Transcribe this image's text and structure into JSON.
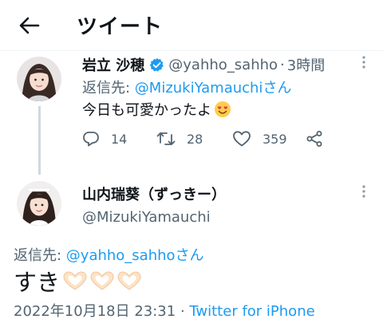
{
  "header": {
    "title": "ツイート",
    "back_icon": "arrow-left-icon"
  },
  "reply_tweet": {
    "author_name": "岩立 沙穂",
    "verified": true,
    "handle": "@yahho_sahho",
    "separator": "·",
    "time": "3時間",
    "reply_prefix": "返信先: ",
    "reply_to": "@MizukiYamauchiさん",
    "text": "今日も可愛かったよ",
    "emoji": "smiling-face-with-heart-eyes-emoji",
    "actions": {
      "reply_count": "14",
      "retweet_count": "28",
      "like_count": "359"
    }
  },
  "main_tweet": {
    "author_name": "山内瑞葵（ずっきー）",
    "handle": "@MizukiYamauchi",
    "reply_prefix": "返信先: ",
    "reply_to": "@yahho_sahhoさん",
    "text": "すき",
    "emoji": "heart-hands-emoji",
    "emoji_count": 3,
    "date": "2022年10月18日 23:31",
    "separator": " · ",
    "client": "Twitter for iPhone"
  },
  "colors": {
    "link": "#1d9bf0",
    "muted": "#536471",
    "text": "#0f1419",
    "thread_line": "#cfd9de"
  }
}
